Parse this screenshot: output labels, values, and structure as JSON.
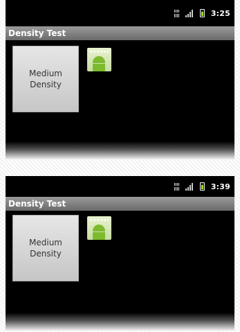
{
  "screens": [
    {
      "status_bar": {
        "time": "3:25"
      },
      "title": "Density Test",
      "density_button_label": "Medium\nDensity"
    },
    {
      "status_bar": {
        "time": "3:39"
      },
      "title": "Density Test",
      "density_button_label": "Medium\nDensity"
    }
  ],
  "colors": {
    "screen_background": "#000000",
    "titlebar": "#7a7a7a",
    "battery_fill": "#9be000",
    "android_green": "#7dbb2e"
  },
  "icons": {
    "status": [
      "sim-icon",
      "signal-icon",
      "battery-icon"
    ],
    "app": "android-app-icon"
  }
}
